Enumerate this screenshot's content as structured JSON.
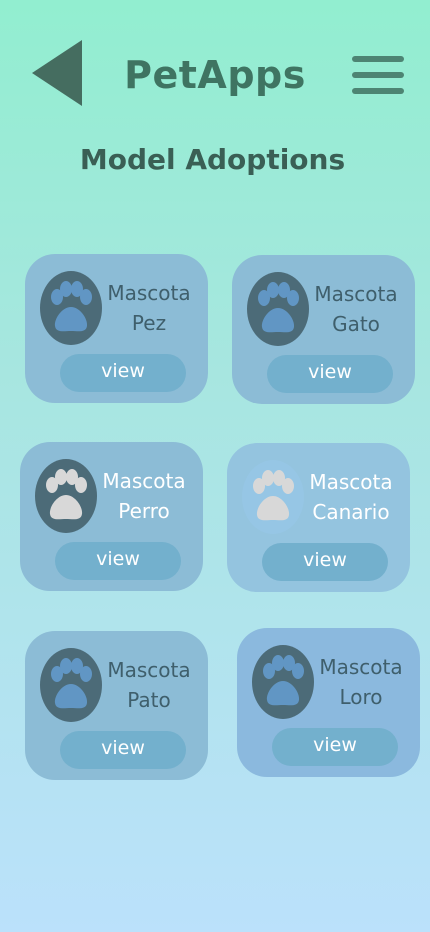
{
  "header": {
    "back_icon": "back-triangle-icon",
    "title": "PetApps",
    "menu_icon": "hamburger-menu-icon"
  },
  "page": {
    "heading": "Model Adoptions"
  },
  "colors": {
    "title": "#3f7462",
    "card": "#8cbcd6",
    "button": "#73b0cd",
    "paw_dark": "#4c6b78"
  },
  "cards": [
    {
      "title": "Mascota",
      "name": "Pez",
      "button": "view",
      "icon": "paw-icon"
    },
    {
      "title": "Mascota",
      "name": "Gato",
      "button": "view",
      "icon": "paw-icon"
    },
    {
      "title": "Mascota",
      "name": "Perro",
      "button": "view",
      "icon": "paw-icon"
    },
    {
      "title": "Mascota",
      "name": "Canario",
      "button": "view",
      "icon": "paw-icon"
    },
    {
      "title": "Mascota",
      "name": "Pato",
      "button": "view",
      "icon": "paw-icon"
    },
    {
      "title": "Mascota",
      "name": "Loro",
      "button": "view",
      "icon": "paw-icon"
    }
  ]
}
